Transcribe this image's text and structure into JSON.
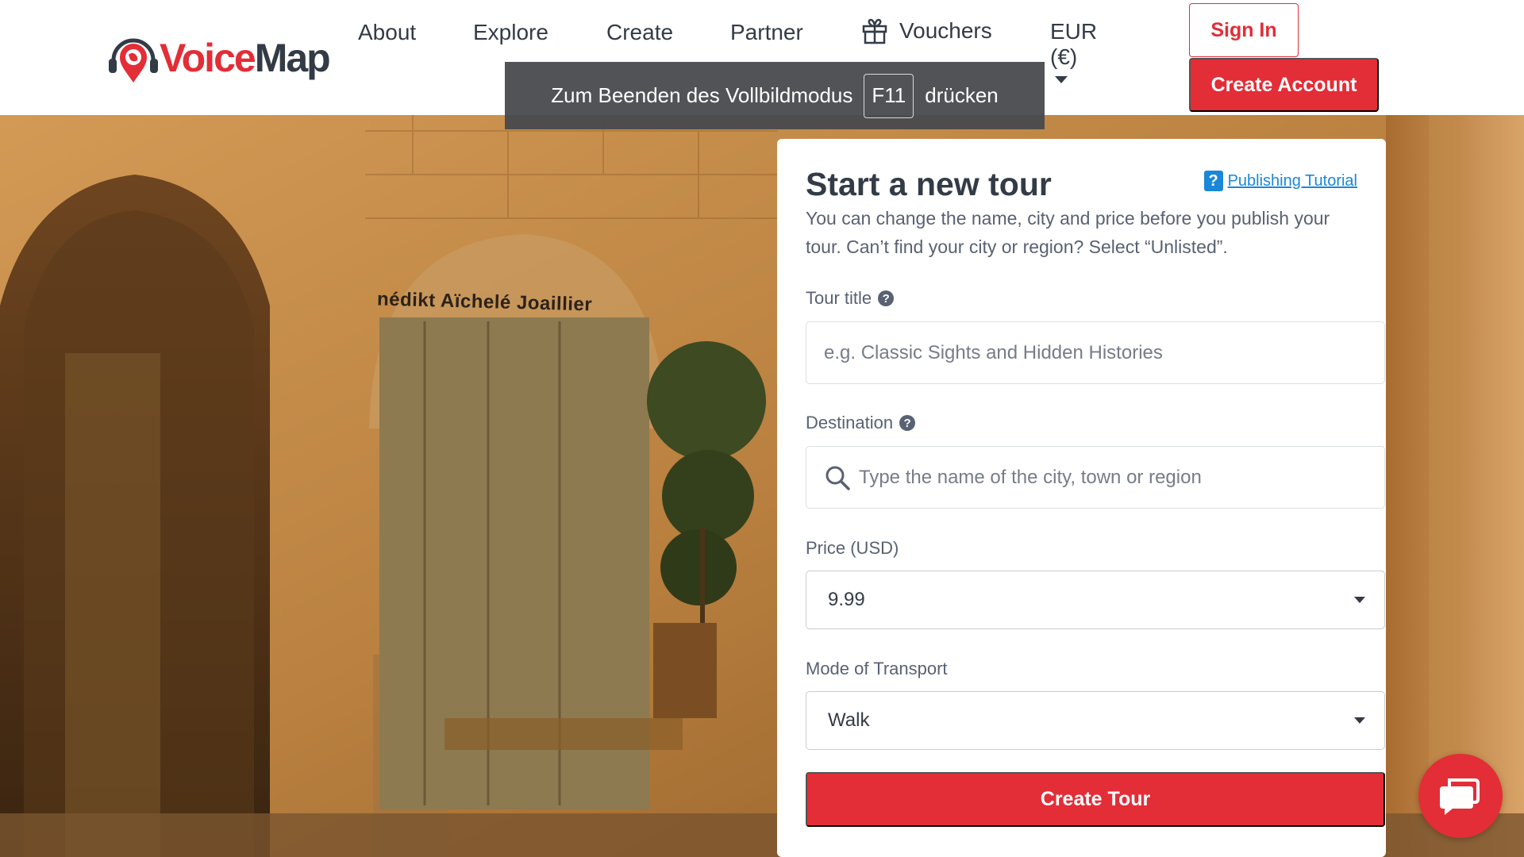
{
  "brand": {
    "name_part1": "Voice",
    "name_part2": "Map",
    "accent_color": "#e32d37",
    "dark_color": "#333b46"
  },
  "nav": {
    "items": [
      {
        "label": "About"
      },
      {
        "label": "Explore"
      },
      {
        "label": "Create"
      },
      {
        "label": "Partner"
      },
      {
        "label": "Vouchers",
        "icon": "gift-icon"
      }
    ],
    "currency": {
      "code": "EUR",
      "symbol": "(€)"
    },
    "sign_in": "Sign In",
    "create_account": "Create Account"
  },
  "fullscreen_notice": {
    "before": "Zum Beenden des Vollbildmodus",
    "key": "F11",
    "after": "drücken"
  },
  "hero": {
    "shop_sign": "nédikt Aïchelé Joaillier"
  },
  "form": {
    "title": "Start a new tour",
    "tutorial_link": "Publishing Tutorial",
    "description": "You can change the name, city and price before you publish your tour. Can’t find your city or region? Select “Unlisted”.",
    "tour_title": {
      "label": "Tour title",
      "placeholder": "e.g. Classic Sights and Hidden Histories",
      "value": ""
    },
    "destination": {
      "label": "Destination",
      "placeholder": "Type the name of the city, town or region",
      "value": ""
    },
    "price": {
      "label": "Price (USD)",
      "selected": "9.99"
    },
    "transport": {
      "label": "Mode of Transport",
      "selected": "Walk"
    },
    "submit": "Create Tour"
  },
  "chat": {
    "icon": "chat-icon"
  }
}
